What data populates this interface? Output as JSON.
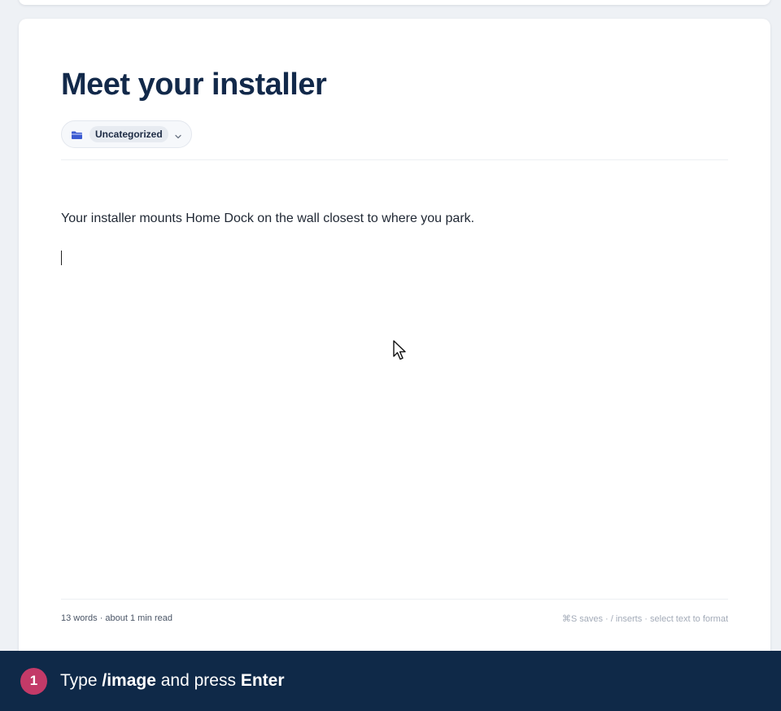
{
  "editor": {
    "title": "Meet your installer",
    "category": "Uncategorized",
    "body_paragraph": "Your installer mounts Home Dock on the wall closest to where you park."
  },
  "footer": {
    "word_count": "13 words · about 1 min read",
    "shortcut_hint": "⌘S saves · / inserts · select text to format"
  },
  "instruction": {
    "step_number": "1",
    "text_before": "Type ",
    "command": "/image",
    "text_middle": " and press ",
    "key": "Enter"
  },
  "icons": {
    "category": "folder-icon",
    "category_toggle": "chevron-down-icon"
  },
  "colors": {
    "title": "#12294a",
    "instruction_bar": "#0f2948",
    "step_badge": "#c33a68",
    "folder_icon": "#3b5bd1"
  }
}
